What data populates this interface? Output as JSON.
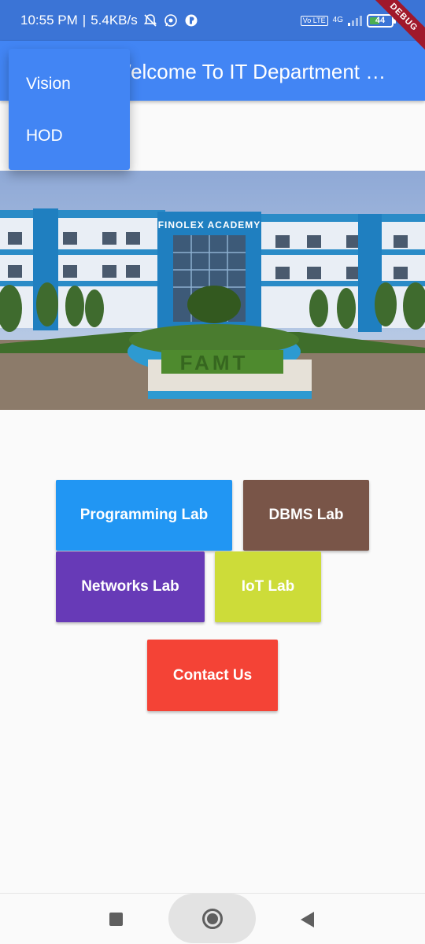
{
  "status_bar": {
    "time": "10:55 PM",
    "separator": "|",
    "speed": "5.4KB/s",
    "network": "4G",
    "volte": "Vo LTE",
    "battery": "44",
    "icons": [
      "alarm-off-icon",
      "whatsapp-icon",
      "app-notification-icon",
      "signal-icon",
      "battery-icon"
    ]
  },
  "debug_banner": "DEBUG",
  "app_bar": {
    "title": "Welcome To IT Department of Finolex Academy"
  },
  "popup_menu": {
    "items": [
      "Vision",
      "HOD"
    ]
  },
  "hero": {
    "sign_text": "FINOLEX ACADEMY",
    "hedge_text": "FAMT"
  },
  "buttons": {
    "programming": "Programming Lab",
    "dbms": "DBMS Lab",
    "networks": "Networks Lab",
    "iot": "IoT Lab",
    "contact": "Contact Us"
  },
  "colors": {
    "status_bar": "#3b74d6",
    "app_bar": "#4285f4",
    "programming": "#2196f3",
    "dbms": "#795548",
    "networks": "#673ab7",
    "iot": "#cddc39",
    "contact": "#f44336"
  },
  "nav_bar": {
    "icons": [
      "recents-square-icon",
      "home-circle-icon",
      "back-triangle-icon"
    ]
  }
}
